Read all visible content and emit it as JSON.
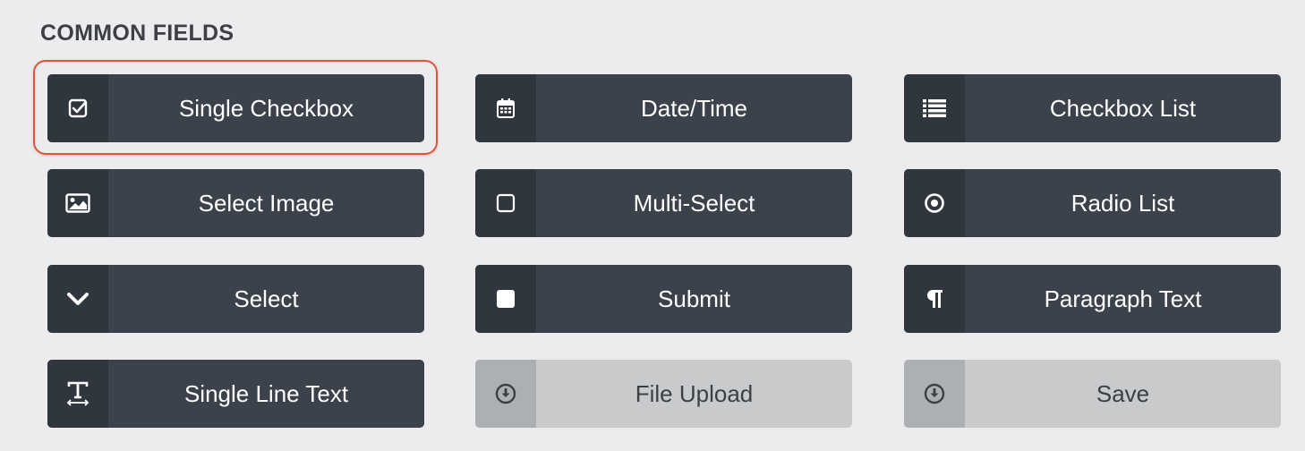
{
  "section": {
    "title": "COMMON FIELDS"
  },
  "fields": [
    {
      "label": "Single Checkbox",
      "icon": "checkbox-icon",
      "disabled": false,
      "highlighted": true
    },
    {
      "label": "Date/Time",
      "icon": "calendar-icon",
      "disabled": false
    },
    {
      "label": "Checkbox List",
      "icon": "list-icon",
      "disabled": false
    },
    {
      "label": "Select Image",
      "icon": "image-icon",
      "disabled": false
    },
    {
      "label": "Multi-Select",
      "icon": "empty-square-icon",
      "disabled": false
    },
    {
      "label": "Radio List",
      "icon": "radio-icon",
      "disabled": false
    },
    {
      "label": "Select",
      "icon": "chevron-down-icon",
      "disabled": false
    },
    {
      "label": "Submit",
      "icon": "filled-square-icon",
      "disabled": false
    },
    {
      "label": "Paragraph Text",
      "icon": "paragraph-icon",
      "disabled": false
    },
    {
      "label": "Single Line Text",
      "icon": "text-width-icon",
      "disabled": false
    },
    {
      "label": "File Upload",
      "icon": "download-circle-icon",
      "disabled": true
    },
    {
      "label": "Save",
      "icon": "download-circle-icon",
      "disabled": true
    }
  ],
  "colors": {
    "button_bg": "#3b424b",
    "icon_cell_bg": "#30363e",
    "disabled_bg": "#c8cacb",
    "highlight_border": "#e0533b"
  }
}
